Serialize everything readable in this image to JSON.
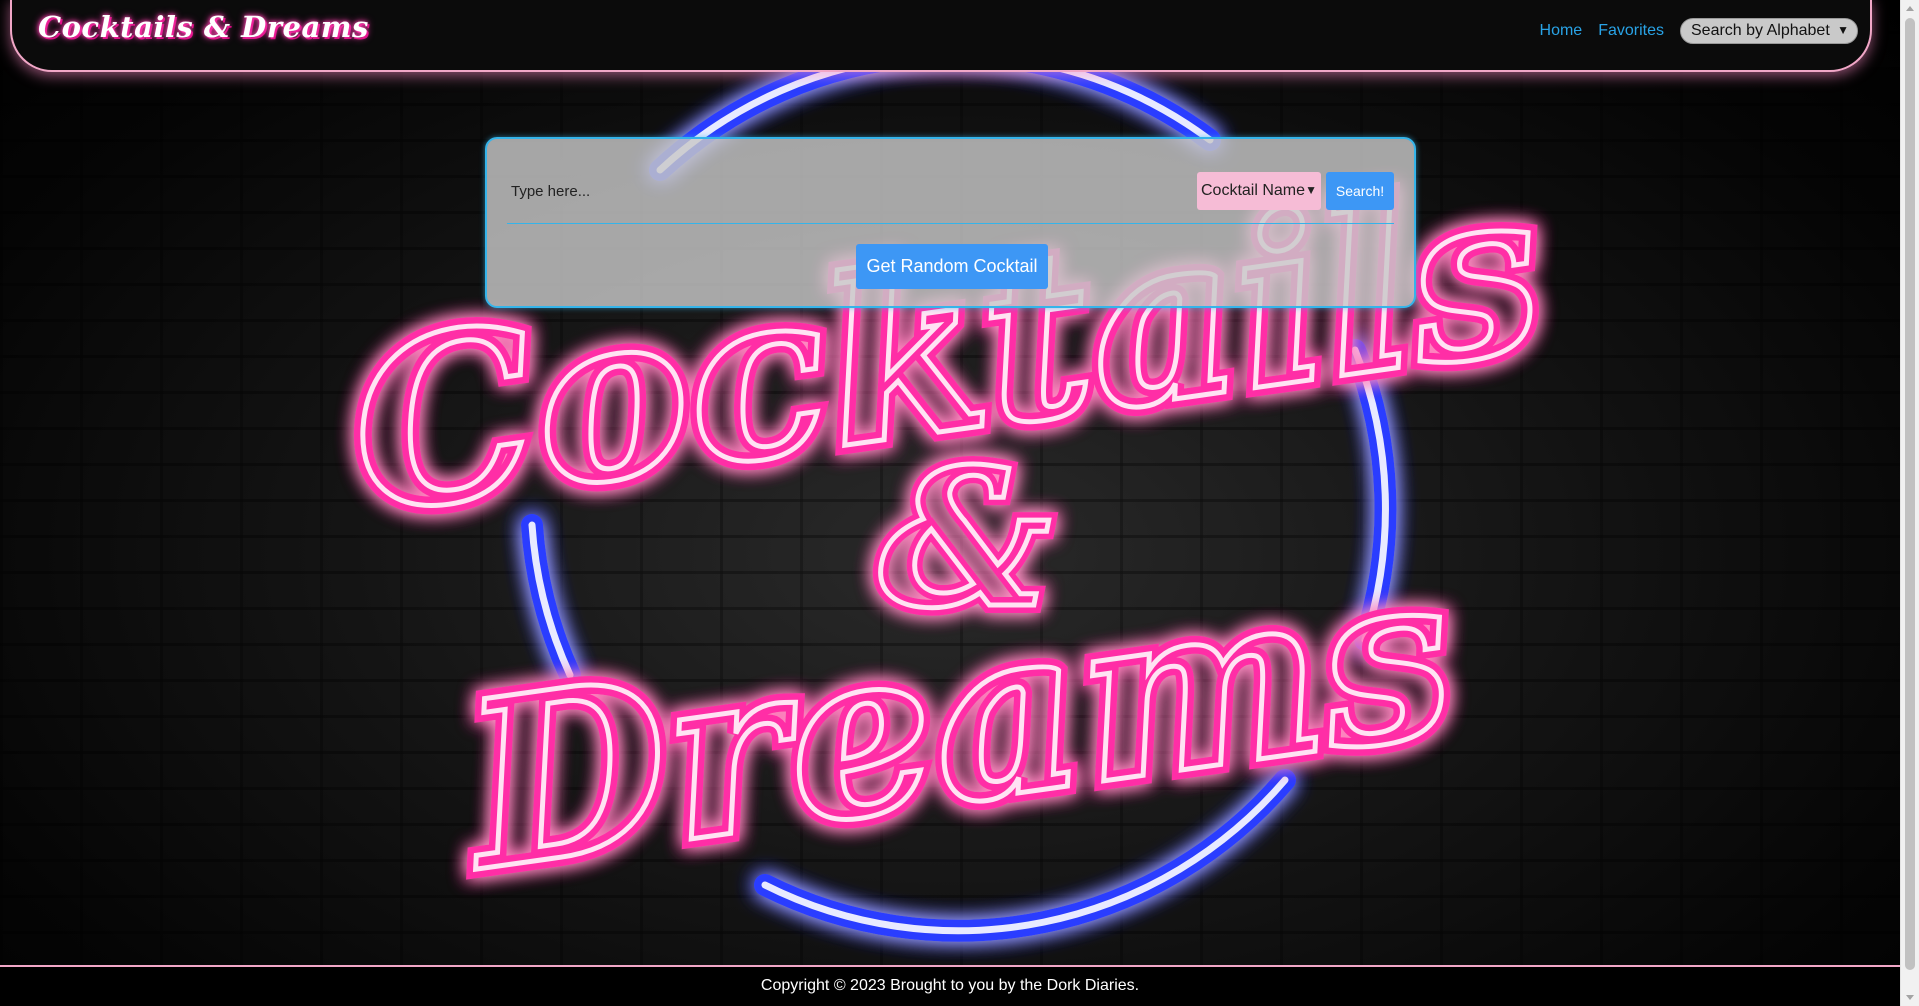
{
  "navbar": {
    "brand": "Cocktails & Dreams",
    "links": [
      "Home",
      "Favorites"
    ],
    "alphabet_select": "Search by Alphabet"
  },
  "search": {
    "placeholder": "Type here...",
    "type_select": "Cocktail Name",
    "search_label": "Search!",
    "random_label": "Get Random Cocktail"
  },
  "footer": {
    "text": "Copyright © 2023 Brought to you by the Dork Diaries."
  },
  "colors": {
    "accent_blue": "#3d97f5",
    "link_blue": "#29a3e6",
    "neon_pink": "#ff3fb0",
    "neon_blue": "#2b3dff",
    "border_pink": "#f1a7c7",
    "select_pink": "#f6bcd6"
  }
}
